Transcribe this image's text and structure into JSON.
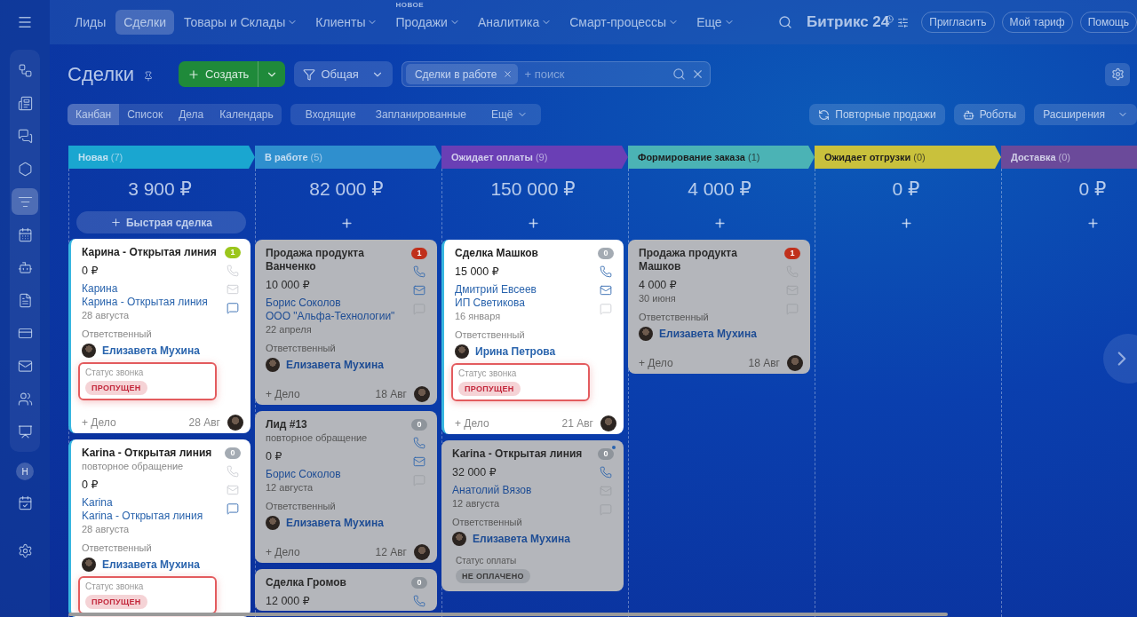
{
  "sidebar": {
    "items": [
      {
        "kind": "network",
        "selected": false
      },
      {
        "kind": "news",
        "selected": false
      },
      {
        "kind": "chat",
        "selected": false
      },
      {
        "kind": "hexagon",
        "selected": false
      },
      {
        "kind": "funnel",
        "selected": true
      },
      {
        "kind": "calendar",
        "selected": false
      },
      {
        "kind": "robot",
        "selected": false
      },
      {
        "kind": "document",
        "selected": false
      },
      {
        "kind": "card",
        "selected": false
      },
      {
        "kind": "mail",
        "selected": false
      },
      {
        "kind": "people",
        "selected": false
      },
      {
        "kind": "presentation",
        "selected": false
      }
    ],
    "avatar": "Н"
  },
  "nav": {
    "items": [
      {
        "label": "Лиды",
        "selected": false,
        "dropdown": false
      },
      {
        "label": "Сделки",
        "selected": true,
        "dropdown": false
      },
      {
        "label": "Товары и Склады",
        "selected": false,
        "dropdown": true
      },
      {
        "label": "Клиенты",
        "selected": false,
        "dropdown": true
      },
      {
        "label": "Продажи",
        "selected": false,
        "dropdown": true,
        "badge": "НОВОЕ"
      },
      {
        "label": "Аналитика",
        "selected": false,
        "dropdown": true
      },
      {
        "label": "Смарт-процессы",
        "selected": false,
        "dropdown": true
      },
      {
        "label": "Еще",
        "selected": false,
        "dropdown": true
      }
    ],
    "logo": "Битрикс 24",
    "buttons": [
      "Пригласить",
      "Мой тариф",
      "Помощь"
    ]
  },
  "toolbar": {
    "title": "Сделки",
    "create": "Создать",
    "filter": "Общая",
    "chip": "Сделки в работе",
    "search_placeholder": "+ поиск"
  },
  "views": {
    "tabs": [
      {
        "label": "Канбан",
        "selected": true
      },
      {
        "label": "Список",
        "selected": false
      },
      {
        "label": "Дела",
        "selected": false
      },
      {
        "label": "Календарь",
        "selected": false
      }
    ],
    "counters": [
      "Входящие",
      "Запланированные"
    ],
    "more": "Ещё",
    "actions": [
      "Повторные продажи",
      "Роботы"
    ],
    "extensions": "Расширения"
  },
  "columns": [
    {
      "name": "Новая",
      "count": "(7)",
      "color": "#1aa6d0",
      "total": "3 900 ₽",
      "quick_add": "Быстрая сделка",
      "cards": [
        {
          "dimmed": false,
          "title": "Карина - Открытая линия",
          "amount": "0 ₽",
          "contacts": [
            "Карина",
            "Карина - Открытая линия"
          ],
          "date": "28 августа",
          "responsible_label": "Ответственный",
          "responsible": "Елизавета Мухина",
          "status": {
            "label": "Статус звонка",
            "value": "ПРОПУЩЕН",
            "kind": "danger",
            "highlighted": true
          },
          "footer": {
            "add": "+ Дело",
            "date": "28 Авг"
          },
          "counter": {
            "value": "1",
            "color": "#9bc61c"
          },
          "phone": false,
          "mail": false,
          "chat": true
        },
        {
          "dimmed": false,
          "title": "Karina - Открытая линия",
          "subtitle": "повторное обращение",
          "amount": "0 ₽",
          "contacts": [
            "Karina",
            "Karina - Открытая линия"
          ],
          "date": "28 августа",
          "responsible_label": "Ответственный",
          "responsible": "Елизавета Мухина",
          "status": {
            "label": "Статус звонка",
            "value": "ПРОПУЩЕН",
            "kind": "danger",
            "highlighted": true
          },
          "counter": {
            "value": "0",
            "color": "#a4abb3"
          },
          "phone": false,
          "mail": false,
          "chat": true
        }
      ]
    },
    {
      "name": "В работе",
      "count": "(5)",
      "color": "#2f8fce",
      "total": "82 000 ₽",
      "cards": [
        {
          "dimmed": true,
          "title": "Продажа продукта Ванченко",
          "amount": "10 000 ₽",
          "contacts": [
            "Борис Соколов",
            "ООО \"Альфа-Технологии\""
          ],
          "date": "22 апреля",
          "responsible_label": "Ответственный",
          "responsible": "Елизавета Мухина",
          "footer": {
            "add": "+ Дело",
            "date": "18 Авг"
          },
          "counter": {
            "value": "1",
            "color": "#c0301c"
          },
          "phone": true,
          "mail": true,
          "chat": false
        },
        {
          "dimmed": true,
          "title": "Лид #13",
          "subtitle": "повторное обращение",
          "amount": "0 ₽",
          "contacts": [
            "Борис Соколов"
          ],
          "date": "12 августа",
          "responsible_label": "Ответственный",
          "responsible": "Елизавета Мухина",
          "footer": {
            "add": "+ Дело",
            "date": "12 Авг"
          },
          "counter": {
            "value": "0",
            "color": "#8e949b"
          },
          "phone": true,
          "mail": true,
          "chat": false
        },
        {
          "dimmed": true,
          "title": "Сделка Громов",
          "amount": "12 000 ₽",
          "counter": {
            "value": "0",
            "color": "#8e949b"
          },
          "phone": true
        }
      ]
    },
    {
      "name": "Ожидает оплаты",
      "count": "(9)",
      "color": "#6a3fb5",
      "total": "150 000 ₽",
      "cards": [
        {
          "dimmed": false,
          "title": "Сделка Машков",
          "amount": "15 000 ₽",
          "contacts": [
            "Дмитрий Евсеев",
            "ИП Светикова"
          ],
          "date": "16 января",
          "responsible_label": "Ответственный",
          "responsible": "Ирина Петрова",
          "status": {
            "label": "Статус звонка",
            "value": "ПРОПУЩЕН",
            "kind": "danger",
            "highlighted": true
          },
          "footer": {
            "add": "+ Дело",
            "date": "21 Авг"
          },
          "counter": {
            "value": "0",
            "color": "#a4abb3"
          },
          "phone": true,
          "mail": true,
          "chat": false
        },
        {
          "dimmed": true,
          "title": "Karina - Открытая линия",
          "amount": "32 000 ₽",
          "contacts": [
            "Анатолий Вязов"
          ],
          "date": "12 августа",
          "responsible_label": "Ответственный",
          "responsible": "Елизавета Мухина",
          "status": {
            "label": "Статус оплаты",
            "value": "НЕ ОПЛАЧЕНО",
            "kind": "neutral",
            "highlighted": false
          },
          "counter": {
            "value": "0",
            "color": "#8e949b",
            "dot": true
          },
          "phone": true,
          "mail": false,
          "chat": false
        }
      ]
    },
    {
      "name": "Формирование заказа",
      "count": "(1)",
      "color": "#4bb3b5",
      "total": "4 000 ₽",
      "cards": [
        {
          "dimmed": true,
          "title": "Продажа продукта Машков",
          "amount": "4 000 ₽",
          "date": "30 июня",
          "responsible_label": "Ответственный",
          "responsible": "Елизавета Мухина",
          "footer": {
            "add": "+ Дело",
            "date": "18 Авг"
          },
          "counter": {
            "value": "1",
            "color": "#c0301c"
          },
          "phone": false,
          "mail": false,
          "chat": false
        }
      ]
    },
    {
      "name": "Ожидает отгрузки",
      "count": "(0)",
      "color": "#c9c13c",
      "total": "0 ₽"
    },
    {
      "name": "Доставка",
      "count": "(0)",
      "color": "#6b4a9a",
      "total": "0 ₽"
    }
  ]
}
